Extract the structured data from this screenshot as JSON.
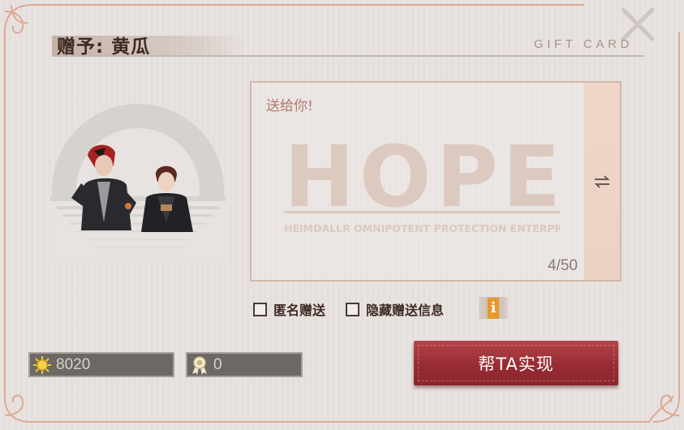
{
  "dialog": {
    "title": "赠予: 黄瓜",
    "subtitle": "GIFT CARD"
  },
  "message": {
    "text": "送给你!",
    "counter": "4/50",
    "watermark_big": "HOPE",
    "watermark_small": "HEIMDALLR OMNIPOTENT PROTECTION ENTERPRISE"
  },
  "options": {
    "anonymous_label": "匿名赠送",
    "hide_info_label": "隐藏赠送信息",
    "anonymous_checked": false,
    "hide_info_checked": false,
    "info_icon_text": "i"
  },
  "currencies": {
    "coin_value": "8020",
    "ticket_value": "0"
  },
  "actions": {
    "confirm_label": "帮TA实现"
  },
  "colors": {
    "accent_red": "#9b2d34",
    "title_brown": "#3e2a24",
    "message_pink": "#b0786a",
    "info_orange": "#e39a2a"
  },
  "icons": {
    "close": "close-icon",
    "swap": "swap-icon",
    "info": "info-icon",
    "coin": "sun-coin-icon",
    "ticket": "ribbon-badge-icon"
  }
}
